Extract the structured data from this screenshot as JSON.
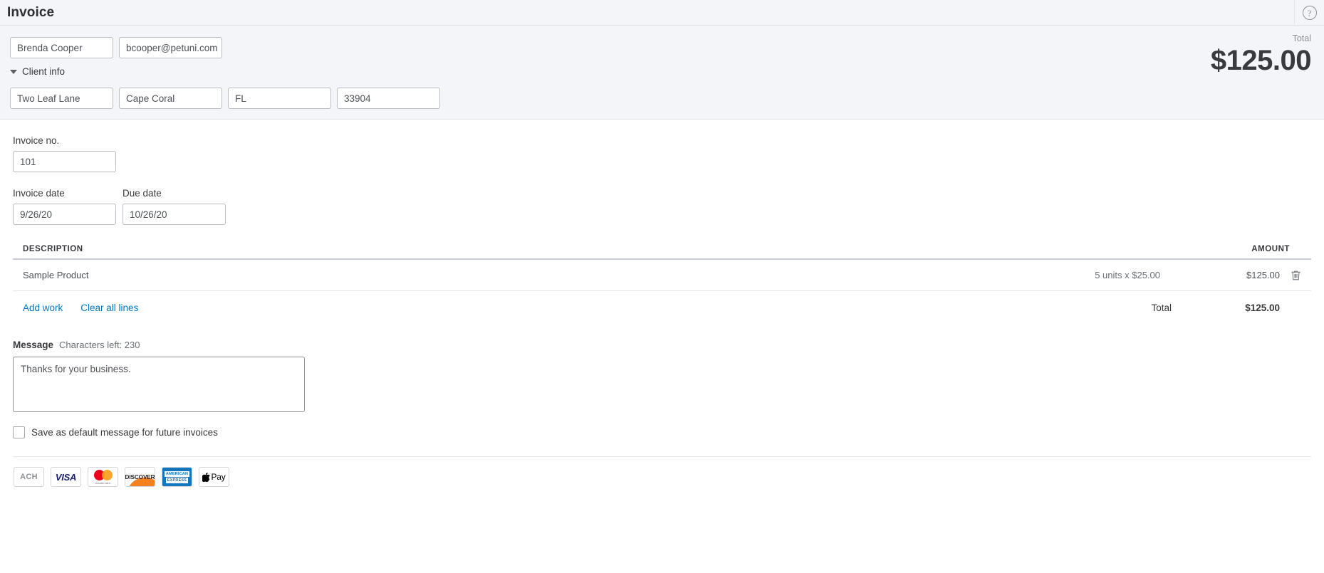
{
  "titlebar": {
    "title": "Invoice",
    "help_icon": "help-circle-icon",
    "help_glyph": "?"
  },
  "customer": {
    "name": "Brenda Cooper",
    "email": "bcooper@petuni.com",
    "client_info_label": "Client info",
    "address": "Two Leaf Lane",
    "city": "Cape Coral",
    "state": "FL",
    "zip": "33904",
    "total_label": "Total",
    "total_amount": "$125.00"
  },
  "invoice": {
    "number_label": "Invoice no.",
    "number": "101",
    "invoice_date_label": "Invoice date",
    "invoice_date": "9/26/20",
    "due_date_label": "Due date",
    "due_date": "10/26/20"
  },
  "table": {
    "columns": {
      "description": "DESCRIPTION",
      "amount": "AMOUNT"
    },
    "rows": [
      {
        "description": "Sample Product",
        "qty_rate": "5 units x $25.00",
        "amount": "$125.00",
        "delete_icon": "trash-icon"
      }
    ],
    "add_work_label": "Add work",
    "clear_all_label": "Clear all lines",
    "total_label": "Total",
    "total_amount": "$125.00"
  },
  "message": {
    "label": "Message",
    "characters_left": "Characters left: 230",
    "text": "Thanks for your business.",
    "save_default_label": "Save as default message for future invoices",
    "checked": false
  },
  "payments": [
    {
      "name": "ach",
      "label": "ACH"
    },
    {
      "name": "visa",
      "label": "VISA"
    },
    {
      "name": "mastercard",
      "label": "mastercard"
    },
    {
      "name": "discover",
      "label": "DISCOVER"
    },
    {
      "name": "amex",
      "label_top": "AMERICAN",
      "label_bottom": "EXPRESS"
    },
    {
      "name": "apple-pay",
      "label": "Pay",
      "glyph": ""
    }
  ],
  "colors": {
    "link": "#0077c5",
    "panel_bg": "#f4f5f8",
    "border": "#e3e5e8",
    "text": "#393a3d",
    "muted": "#6b6f75"
  }
}
